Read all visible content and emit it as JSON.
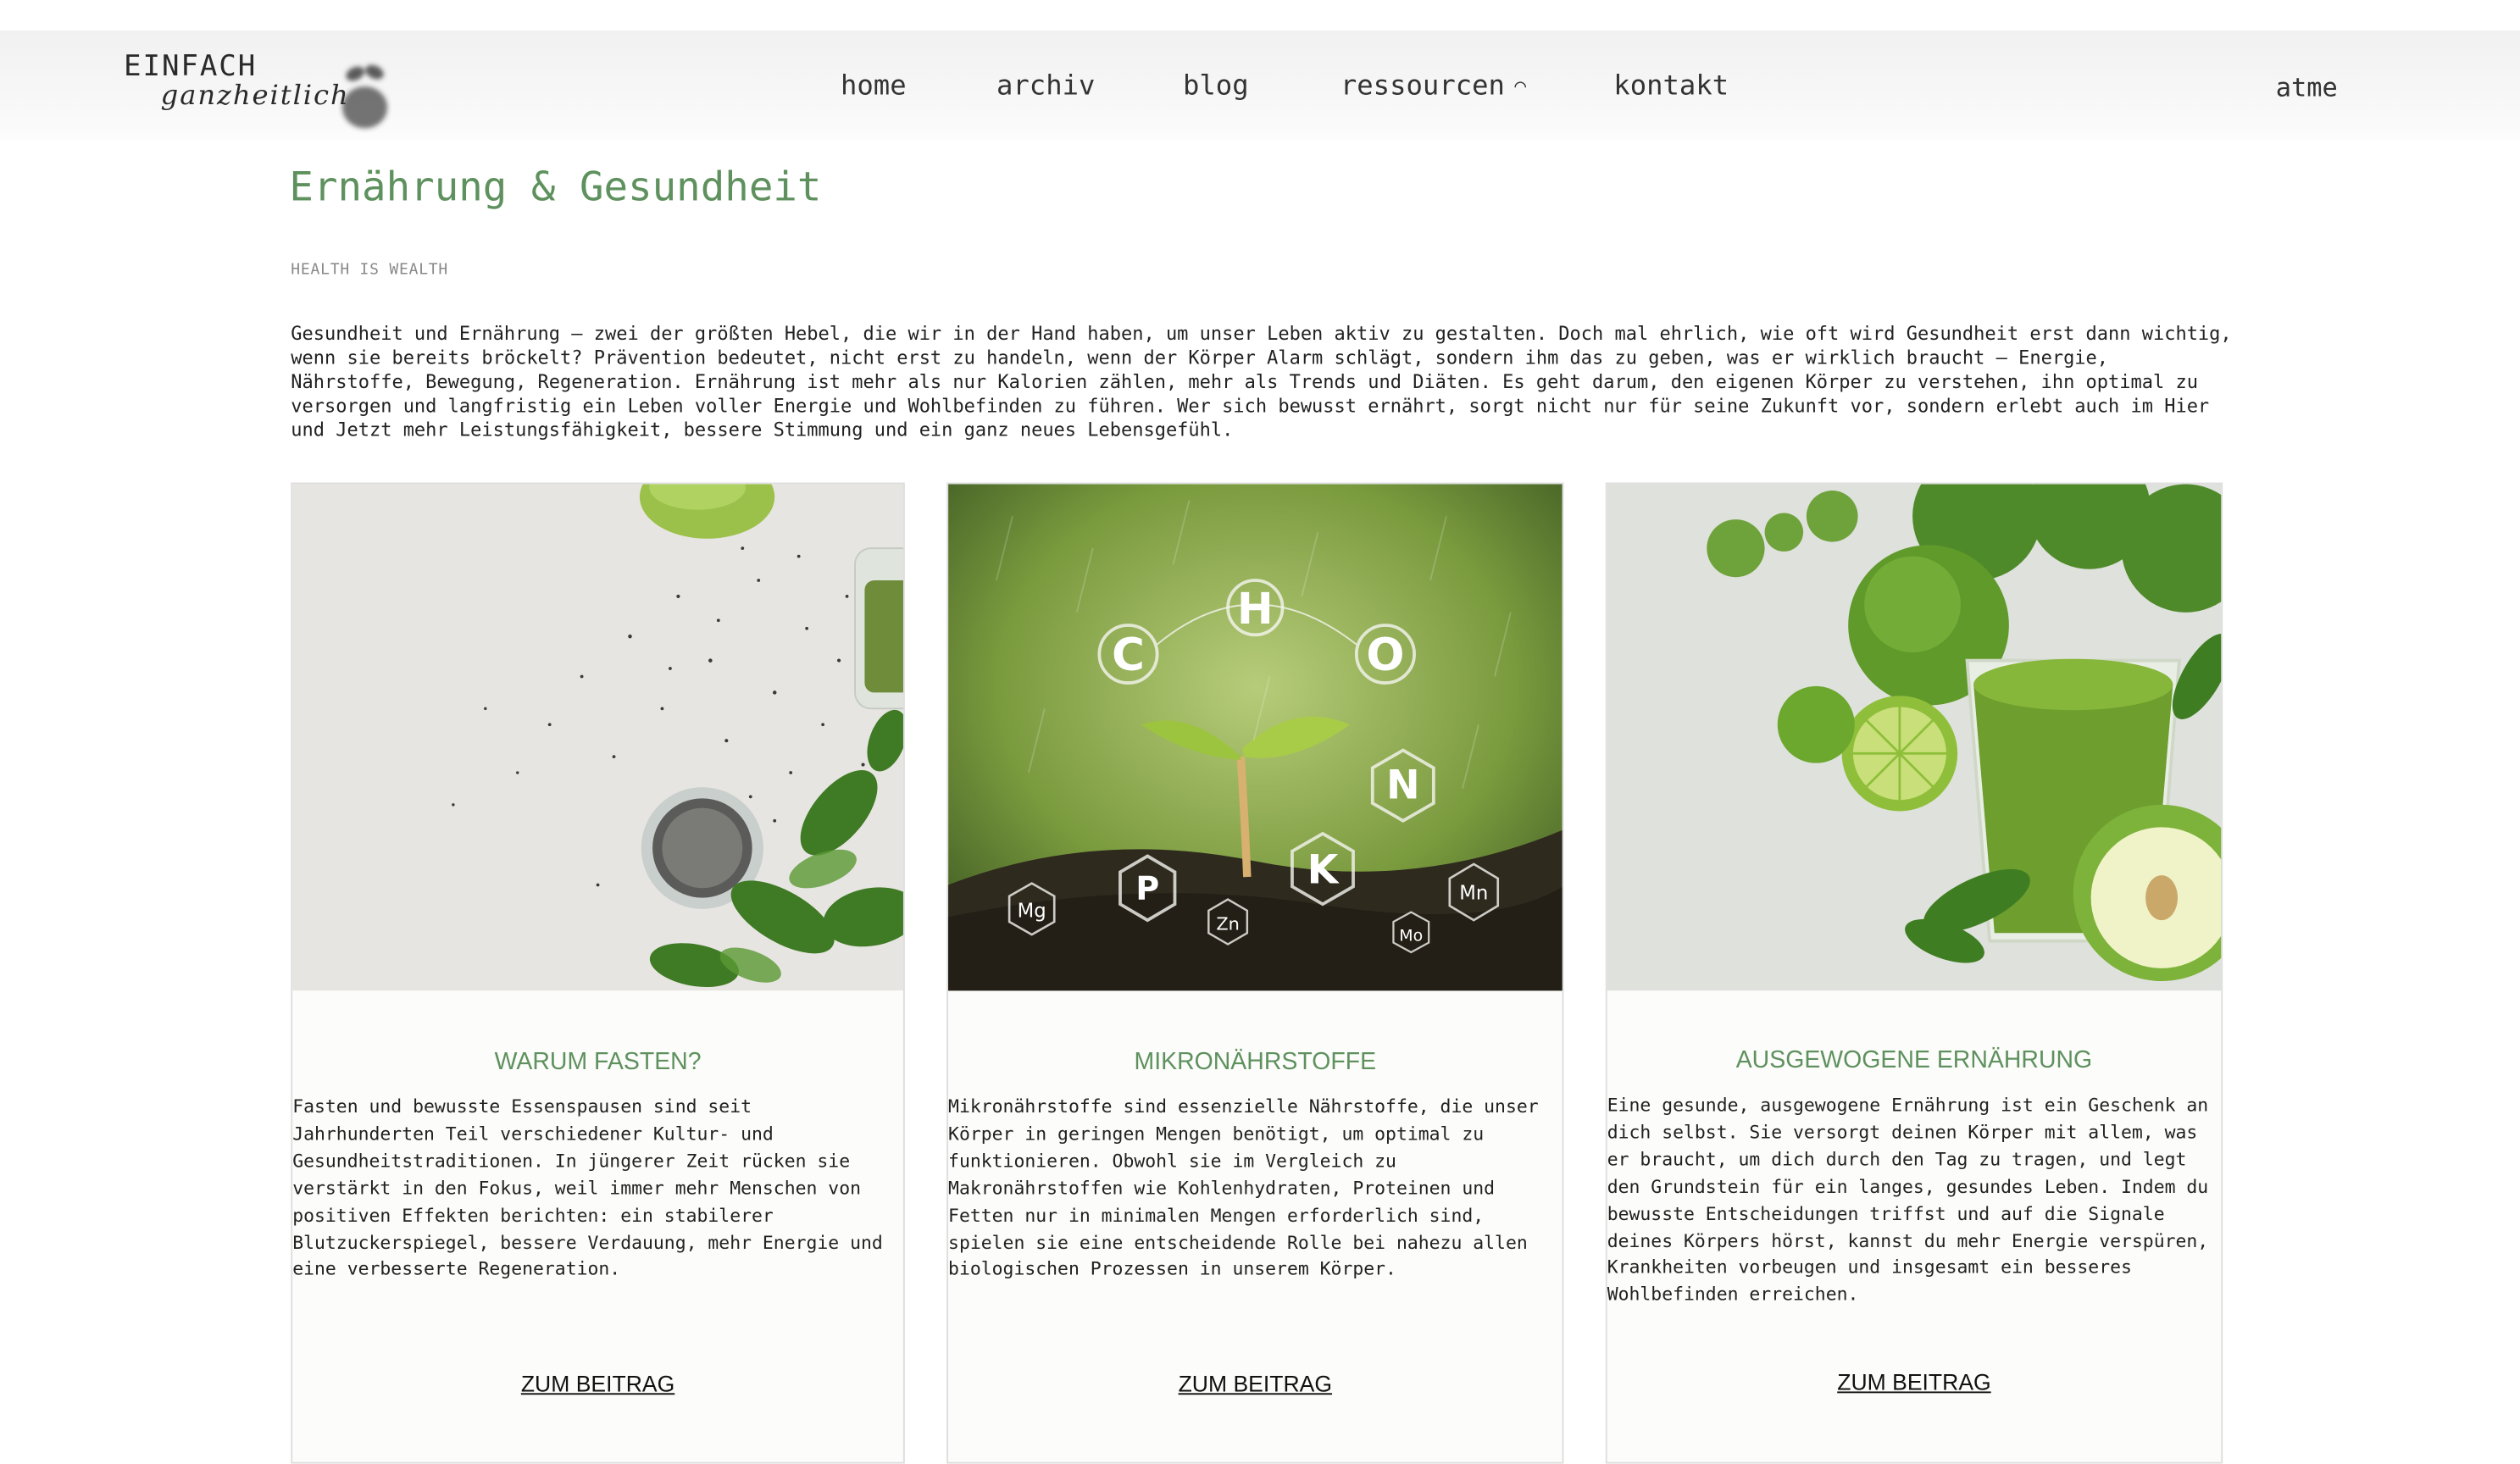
{
  "header": {
    "logo": {
      "line1": "EINFACH",
      "line2": "ganzheitlich"
    },
    "nav": [
      {
        "label": "home"
      },
      {
        "label": "archiv"
      },
      {
        "label": "blog"
      },
      {
        "label": "ressourcen"
      },
      {
        "label": "kontakt"
      }
    ],
    "right_link": "atme"
  },
  "main": {
    "title": "Ernährung & Gesundheit",
    "kicker": "HEALTH IS WEALTH",
    "intro": "Gesundheit und Ernährung – zwei der größten Hebel, die wir in der Hand haben, um unser Leben aktiv zu gestalten. Doch mal ehrlich, wie oft wird Gesundheit erst dann wichtig, wenn sie bereits bröckelt? Prävention bedeutet, nicht erst zu handeln, wenn der Körper Alarm schlägt, sondern ihm das zu geben, was er wirklich braucht – Energie, Nährstoffe, Bewegung, Regeneration. Ernährung ist mehr als nur Kalorien zählen, mehr als Trends und Diäten. Es geht darum, den eigenen Körper zu verstehen, ihn optimal zu versorgen und langfristig ein Leben voller Energie und Wohlbefinden zu führen. Wer sich bewusst ernährt, sorgt nicht nur für seine Zukunft vor, sondern erlebt auch im Hier und Jetzt mehr Leistungsfähigkeit, bessere Stimmung und ein ganz neues Lebensgefühl.",
    "cards": [
      {
        "title": "WARUM FASTEN?",
        "text": "Fasten und bewusste Essenspausen sind seit Jahrhunderten Teil verschiedener Kultur- und Gesundheitstraditionen. In jüngerer Zeit rücken sie verstärkt in den Fokus, weil immer mehr Menschen von positiven Effekten berichten: ein stabilerer Blutzuckerspiegel, bessere Verdauung, mehr Energie und eine verbesserte Regeneration.",
        "link": "ZUM BEITRAG"
      },
      {
        "title": "MIKRONÄHRSTOFFE",
        "text": "Mikronährstoffe sind essenzielle Nährstoffe, die unser Körper in geringen Mengen benötigt, um optimal zu funktionieren. Obwohl sie im Vergleich zu Makronährstoffen wie Kohlenhydraten, Proteinen und Fetten nur in minimalen Mengen erforderlich sind, spielen sie eine entscheidende Rolle bei nahezu allen biologischen Prozessen in unserem Körper.",
        "link": "ZUM BEITRAG",
        "image_symbols": [
          "C",
          "H",
          "O",
          "N",
          "K",
          "P",
          "Mg",
          "Zn",
          "Mn",
          "Mo"
        ]
      },
      {
        "title": "AUSGEWOGENE ERNÄHRUNG",
        "text": "Eine gesunde, ausgewogene Ernährung ist ein Geschenk an dich selbst. Sie versorgt deinen Körper mit allem, was er braucht, um dich durch den Tag zu tragen, und legt den Grundstein für ein langes, gesundes Leben. Indem du bewusste Entscheidungen triffst und auf die Signale deines Körpers hörst, kannst du mehr Energie verspüren, Krankheiten vorbeugen und insgesamt ein besseres Wohlbefinden erreichen.",
        "link": "ZUM BEITRAG"
      }
    ]
  },
  "colors": {
    "accent": "#5e915e",
    "header_bg": "#f3f3f3",
    "text": "#222222"
  }
}
